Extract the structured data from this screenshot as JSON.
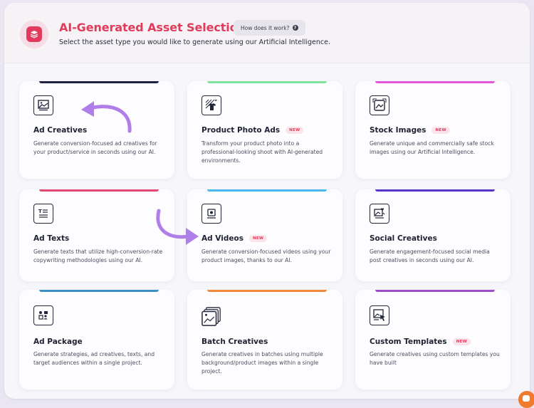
{
  "header": {
    "title": "AI-Generated Asset Selection",
    "subtitle": "Select the asset type you would like to generate using our Artificial Intelligence.",
    "help_button": "How does it work?",
    "help_icon": "?"
  },
  "colors": {
    "brand": "#e23a5b",
    "annotation_arrow": "#b07ee8"
  },
  "cards": [
    {
      "title": "Ad Creatives",
      "badge": "",
      "icon": "image-frame-icon",
      "accent": "#1f2140",
      "description": "Generate conversion-focused ad creatives for your product/service in seconds using our AI."
    },
    {
      "title": "Product Photo Ads",
      "badge": "NEW",
      "icon": "product-photo-icon",
      "accent": "#7fe39a",
      "description": "Transform your product photo into a professional-looking shoot with AI-generated environments."
    },
    {
      "title": "Stock Images",
      "badge": "NEW",
      "icon": "stock-image-icon",
      "accent": "#e257d9",
      "description": "Generate unique and commercially safe stock images using our Artificial Intelligence."
    },
    {
      "title": "Ad Texts",
      "badge": "",
      "icon": "text-document-icon",
      "accent": "#e44872",
      "description": "Generate texts that utilize high-conversion-rate copywriting methodologies using our AI."
    },
    {
      "title": "Ad Videos",
      "badge": "NEW",
      "icon": "video-icon",
      "accent": "#49b7ee",
      "description": "Generate conversion-focused videos using your product images, thanks to our AI."
    },
    {
      "title": "Social Creatives",
      "badge": "",
      "icon": "social-post-icon",
      "accent": "#5a35c8",
      "description": "Generate engagement-focused social media post creatives in seconds using our AI."
    },
    {
      "title": "Ad Package",
      "badge": "",
      "icon": "package-icon",
      "accent": "#3e8fc7",
      "description": "Generate strategies, ad creatives, texts, and target audiences within a single project."
    },
    {
      "title": "Batch Creatives",
      "badge": "",
      "icon": "stacked-images-icon",
      "accent": "#f08a3a",
      "description": "Generate creatives in batches using multiple background/product images within a single project."
    },
    {
      "title": "Custom Templates",
      "badge": "NEW",
      "icon": "template-cursor-icon",
      "accent": "#a04cc9",
      "description": "Generate creatives using custom templates you have built"
    }
  ]
}
